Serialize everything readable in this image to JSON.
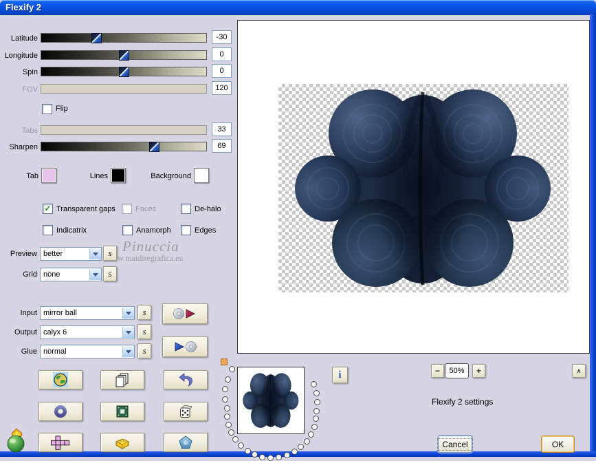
{
  "window": {
    "title": "Flexify 2"
  },
  "sliders": [
    {
      "label": "Latitude",
      "value": "-30",
      "pct": 33,
      "disabled": false
    },
    {
      "label": "Longitude",
      "value": "0",
      "pct": 49.5,
      "disabled": false
    },
    {
      "label": "Spin",
      "value": "0",
      "pct": 49.5,
      "disabled": false
    },
    {
      "label": "FOV",
      "value": "120",
      "pct": null,
      "disabled": true
    },
    {
      "label": "Tabs",
      "value": "33",
      "pct": null,
      "disabled": true
    },
    {
      "label": "Sharpen",
      "value": "69",
      "pct": 68,
      "disabled": false
    }
  ],
  "flip": {
    "label": "Flip",
    "checked": false
  },
  "swatches": [
    {
      "label": "Tab",
      "color": "#e9c4e8"
    },
    {
      "label": "Lines",
      "color": "#000000"
    },
    {
      "label": "Background",
      "color": "#ffffff"
    }
  ],
  "checkboxes": [
    {
      "label": "Transparent gaps",
      "checked": true,
      "disabled": false
    },
    {
      "label": "Faces",
      "checked": false,
      "disabled": true
    },
    {
      "label": "De-halo",
      "checked": false,
      "disabled": false
    },
    {
      "label": "Indicatrix",
      "checked": false,
      "disabled": false
    },
    {
      "label": "Anamorph",
      "checked": false,
      "disabled": false
    },
    {
      "label": "Edges",
      "checked": false,
      "disabled": false
    }
  ],
  "combos": [
    {
      "label": "Preview",
      "value": "better"
    },
    {
      "label": "Grid",
      "value": "none"
    },
    {
      "label": "Input",
      "value": "mirror ball"
    },
    {
      "label": "Output",
      "value": "calyx 6"
    },
    {
      "label": "Glue",
      "value": "normal"
    }
  ],
  "glyphs": {
    "s": "s",
    "info": "i",
    "check": "✓",
    "minus": "−",
    "plus": "+",
    "collapse": "∧"
  },
  "zoom": {
    "level": "50%"
  },
  "status_text": "Flexify 2 settings",
  "buttons": {
    "cancel": "Cancel",
    "ok": "OK"
  },
  "watermark": {
    "line1": "Pinuccia",
    "line2": "-www.maidiregrafica.eu"
  },
  "icons": {
    "cd_load": "cd-play-icon",
    "cd_save": "play-cd-icon",
    "globe": "globe-icon",
    "copy": "copy-pages-icon",
    "undo": "undo-arrow-icon",
    "torus": "torus-icon",
    "chip": "green-chip-icon",
    "dice": "dice-icon",
    "cube_net": "cube-net-icon",
    "lego": "lego-brick-icon",
    "polyhedron": "blue-polyhedron-icon",
    "pear": "flaming-pear-logo",
    "info": "info-icon",
    "random": "random-seed-icon"
  },
  "colors": {
    "dialog_bg": "#d7d4e3",
    "titlebar_blue": "#0a50e2",
    "frame_blue": "#0a44d4",
    "button_face": "#f1eedd",
    "combo_border": "#7f9db9",
    "ok_border": "#c98c1e",
    "cancel_border": "#6a88b8",
    "check_green": "#18a018",
    "flower_dark": "#0b1322",
    "flower_mid": "#2b3e5c",
    "flower_light": "#4d6486"
  }
}
